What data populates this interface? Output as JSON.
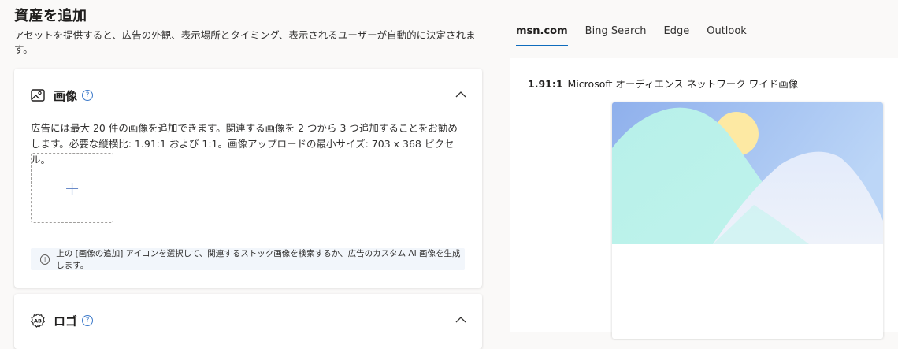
{
  "page": {
    "title": "資産を追加",
    "description": "アセットを提供すると、広告の外観、表示場所とタイミング、表示されるユーザーが自動的に決定されます。"
  },
  "images_card": {
    "title": "画像",
    "icon": "image-icon",
    "help_glyph": "?",
    "description": "広告には最大 20 件の画像を追加できます。関連する画像を 2 つから 3 つ追加することをお勧めします。必要な縦横比: 1.91:1 および 1:1。画像アップロードの最小サイズ: 703 x 368 ピクセル。",
    "add_glyph": "+",
    "info_glyph": "i",
    "info_text": "上の [画像の追加] アイコンを選択して、関連するストック画像を検索するか、広告のカスタム AI 画像を生成します。"
  },
  "logo_card": {
    "title": "ロゴ",
    "icon": "logo-ab-icon",
    "help_glyph": "?"
  },
  "preview": {
    "tabs": [
      {
        "label": "msn.com",
        "active": true
      },
      {
        "label": "Bing Search",
        "active": false
      },
      {
        "label": "Edge",
        "active": false
      },
      {
        "label": "Outlook",
        "active": false
      }
    ],
    "ratio": "1.91:1",
    "ratio_description": "Microsoft オーディエンス ネットワーク ワイド画像"
  },
  "colors": {
    "accent": "#0f6cbd",
    "sky_top": "#8fb0ec",
    "sky_bottom": "#bcd6f7",
    "sun": "#fde9a3",
    "mountain_front": "#b9f1ea",
    "mountain_back": "#e6edfa"
  }
}
